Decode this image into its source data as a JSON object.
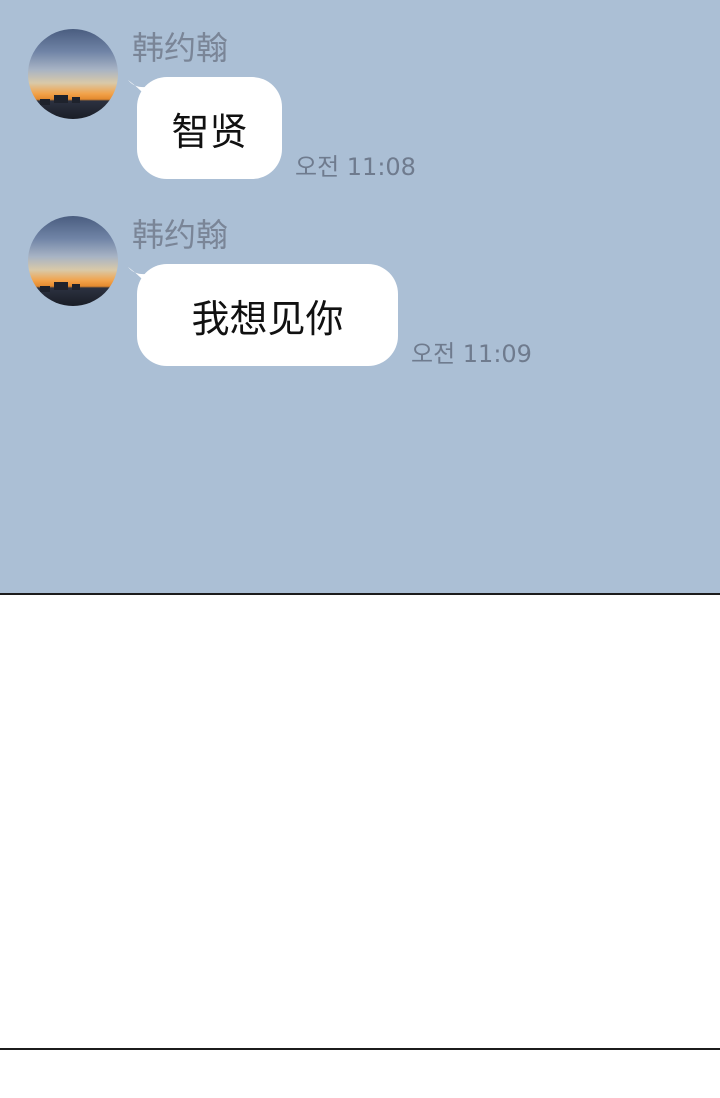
{
  "messages": [
    {
      "sender": "韩约翰",
      "text": "智贤",
      "time": "오전 11:08"
    },
    {
      "sender": "韩约翰",
      "text": "我想见你",
      "time": "오전 11:09"
    }
  ],
  "colors": {
    "chat_background": "#abbfd5",
    "bubble": "#ffffff",
    "sender_name": "#7a8597",
    "timestamp": "#6f7b8e",
    "border": "#1c1c1c"
  }
}
